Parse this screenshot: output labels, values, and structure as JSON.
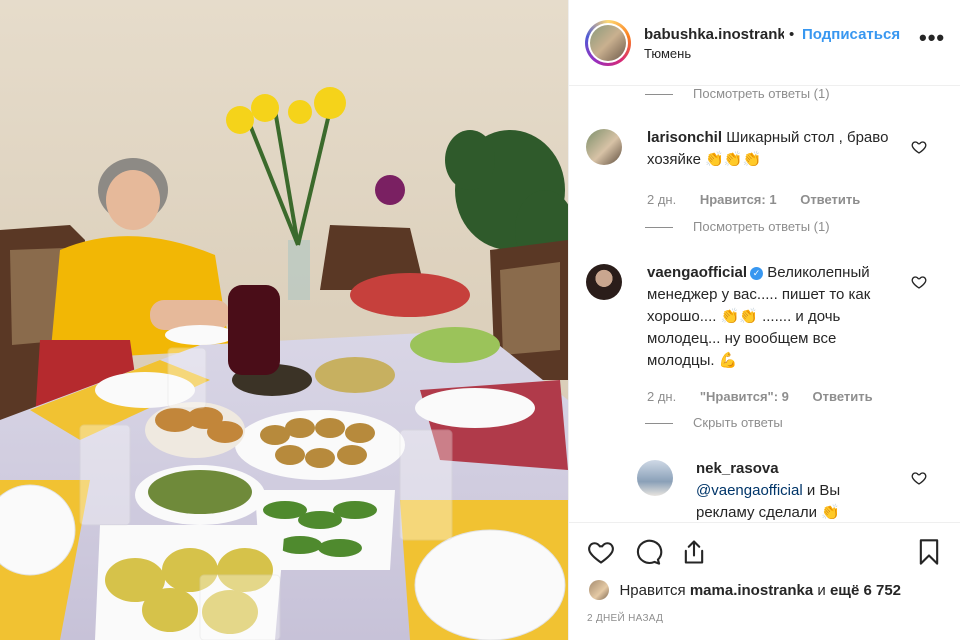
{
  "header": {
    "username": "babushka.inostranka",
    "dot": "•",
    "follow_label": "Подписаться",
    "location": "Тюмень",
    "more_label": "•••"
  },
  "comments": {
    "top_view_replies": "Посмотреть ответы (1)",
    "items": [
      {
        "username": "larisonchil",
        "text": "Шикарный стол , браво хозяйке 👏👏👏",
        "time": "2 дн.",
        "likes": "Нравится: 1",
        "reply": "Ответить",
        "view_replies": "Посмотреть ответы (1)"
      },
      {
        "username": "vaengaofficial",
        "verified_mark": "✓",
        "text": "Великолепный менеджер у вас..... пишет то как хорошо.... 👏👏 ....... и дочь молодец... ну вообщем все молодцы. 💪",
        "time": "2 дн.",
        "likes": "\"Нравится\": 9",
        "reply": "Ответить",
        "hide_replies": "Скрыть ответы"
      },
      {
        "username": "nek_rasova",
        "mention": "@vaengaofficial",
        "text": " и Вы рекламу сделали 👏"
      }
    ]
  },
  "actions": {
    "likes_prefix": "Нравится",
    "likes_user": "mama.inostranka",
    "likes_and": "и",
    "likes_count": "ещё 6 752",
    "post_time": "2 ДНЕЙ НАЗАД"
  },
  "icons": {
    "heart": "heart-icon",
    "comment": "comment-icon",
    "share": "share-icon",
    "bookmark": "bookmark-icon",
    "more": "more-icon"
  }
}
